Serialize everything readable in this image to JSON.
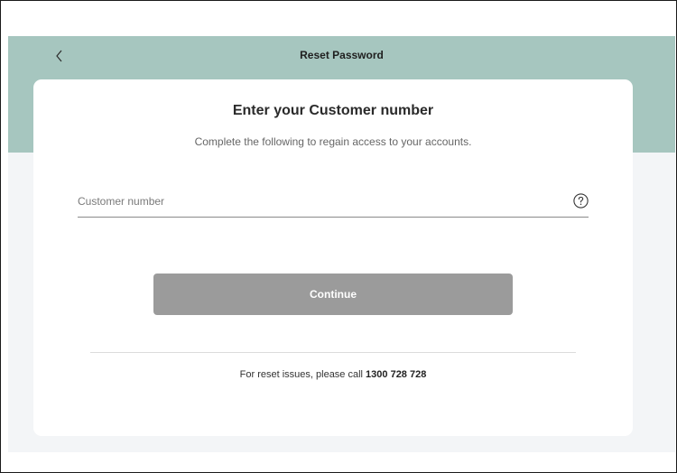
{
  "header": {
    "title": "Reset Password",
    "back_icon": "chevron-left-icon"
  },
  "card": {
    "heading": "Enter your Customer number",
    "subheading": "Complete the following to regain access to your accounts.",
    "customer_number_field": {
      "placeholder": "Customer number",
      "value": "",
      "help_icon": "question-circle-icon"
    },
    "continue_label": "Continue",
    "footer": {
      "text": "For reset issues, please call ",
      "phone": "1300 728 728"
    }
  },
  "colors": {
    "header_band": "#a6c6bf",
    "page_background": "#f3f5f7",
    "button_disabled": "#9b9b9b"
  }
}
